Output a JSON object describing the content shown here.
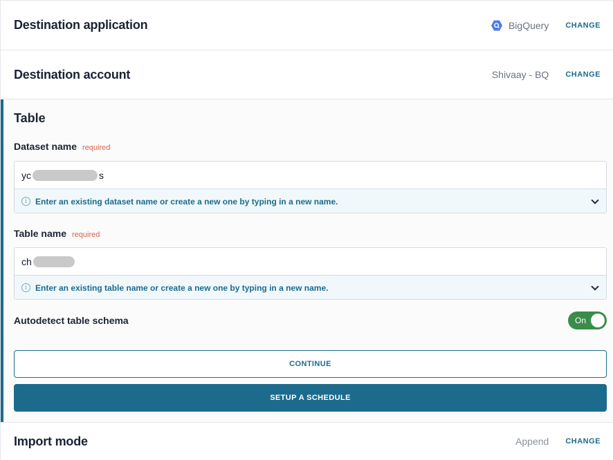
{
  "destination_application": {
    "title": "Destination application",
    "value": "BigQuery",
    "icon": "bigquery-icon",
    "change_label": "CHANGE"
  },
  "destination_account": {
    "title": "Destination account",
    "value": "Shivaay - BQ",
    "change_label": "CHANGE"
  },
  "table": {
    "title": "Table",
    "dataset": {
      "label": "Dataset name",
      "required": "required",
      "value_prefix": "yc",
      "value_suffix": "s",
      "hint": "Enter an existing dataset name or create a new one by typing in a new name."
    },
    "table_name": {
      "label": "Table name",
      "required": "required",
      "value_prefix": "ch",
      "hint": "Enter an existing table name or create a new one by typing in a new name."
    },
    "autodetect": {
      "label": "Autodetect table schema",
      "toggle_text": "On",
      "state": true
    },
    "continue_label": "CONTINUE",
    "schedule_label": "SETUP A SCHEDULE"
  },
  "import_mode": {
    "title": "Import mode",
    "value": "Append",
    "change_label": "CHANGE"
  },
  "colors": {
    "accent": "#1c6b8c",
    "toggle_on": "#3a8c4a",
    "required": "#d8644a"
  }
}
